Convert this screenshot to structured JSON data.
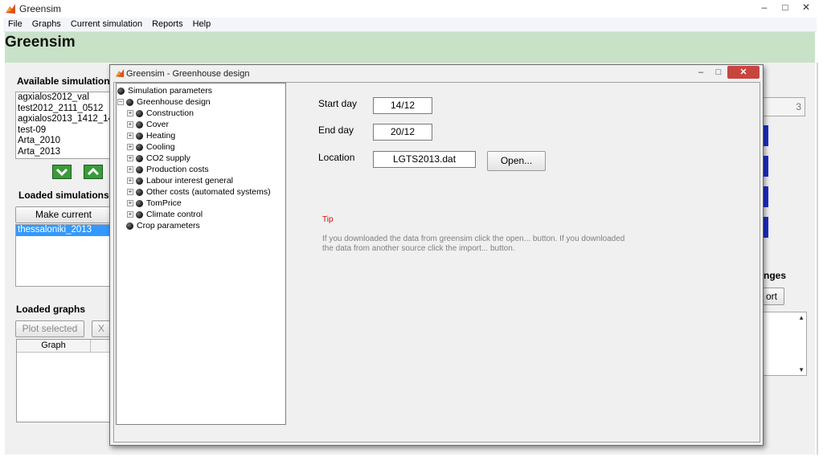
{
  "window": {
    "title": "Greensim",
    "controls": {
      "minimize": "–",
      "maximize": "□",
      "close": "✕"
    }
  },
  "menu": [
    "File",
    "Graphs",
    "Current simulation",
    "Reports",
    "Help"
  ],
  "app_heading": "Greensim",
  "available": {
    "label": "Available simulations",
    "items": [
      "agxialos2012_val",
      "test2012_2111_0512",
      "agxialos2013_1412_14",
      "test-09",
      "Arta_2010",
      "Arta_2013"
    ]
  },
  "loaded_sims": {
    "label": "Loaded simulations:",
    "make_current": "Make current",
    "items": [
      "thessaloniki_2013"
    ]
  },
  "loaded_graphs": {
    "label": "Loaded graphs",
    "plot_selected": "Plot selected",
    "remove": "X",
    "column": "Graph"
  },
  "right_side": {
    "value": "3",
    "label_fragment": "nges",
    "button_fragment": "ort",
    "scroll_up": "▲",
    "scroll_down": "▼"
  },
  "dialog": {
    "title": "Greensim - Greenhouse design",
    "controls": {
      "minimize": "–",
      "maximize": "□",
      "close": "✕"
    },
    "tree": {
      "root": "Simulation parameters",
      "group": "Greenhouse design",
      "children": [
        "Construction",
        "Cover",
        "Heating",
        "Cooling",
        "CO2 supply",
        "Production costs",
        "Labour interest general",
        "Other costs (automated systems)",
        "TomPrice",
        "Climate control"
      ],
      "crop": "Crop parameters"
    },
    "start_day": {
      "label": "Start day",
      "value": "14/12"
    },
    "end_day": {
      "label": "End day",
      "value": "20/12"
    },
    "location": {
      "label": "Location",
      "value": "LGTS2013.dat",
      "open_button": "Open..."
    },
    "tip_label": "Tip",
    "tip_text": "If you downloaded the data from greensim click the open... button. If you downloaded the data from another source click the import... button."
  }
}
